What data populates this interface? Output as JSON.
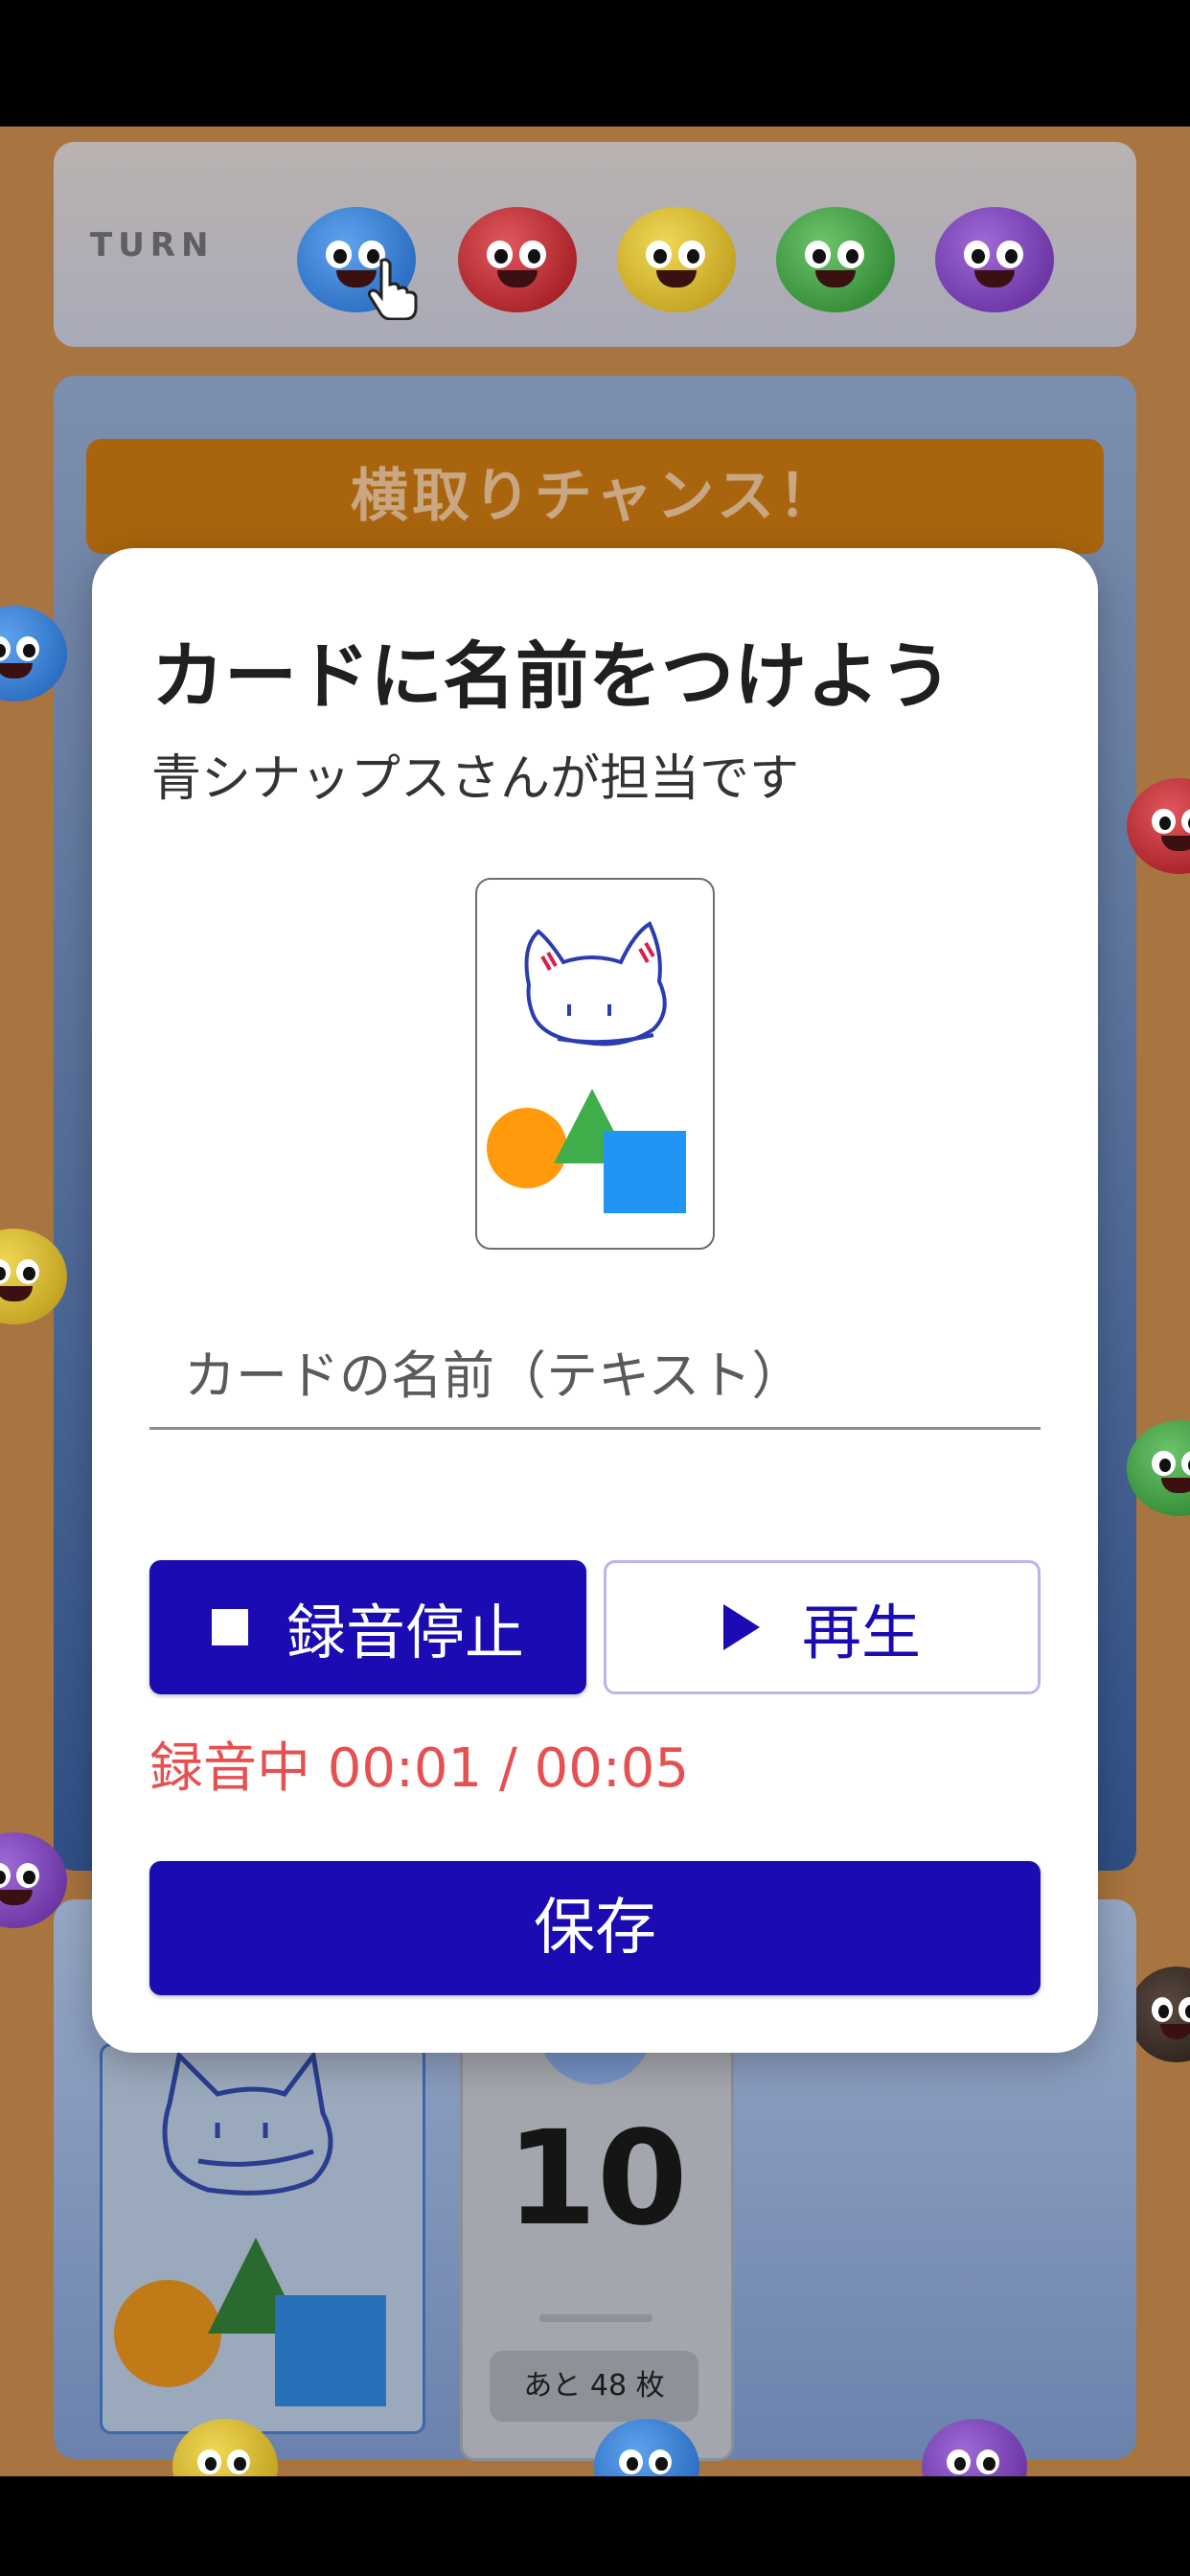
{
  "game": {
    "turn_label": "TURN",
    "banner": "横取りチャンス！",
    "deck": {
      "count": "10",
      "remaining": "あと 48 枚"
    },
    "players": [
      {
        "color": "#2b78d6"
      },
      {
        "color": "#c6202a"
      },
      {
        "color": "#d9b81c"
      },
      {
        "color": "#3a9a3b"
      },
      {
        "color": "#7a3fb5"
      }
    ]
  },
  "modal": {
    "title": "カードに名前をつけよう",
    "subtitle": "青シナップスさんが担当です",
    "name_placeholder": "カードの名前（テキスト）",
    "stop_label": "録音停止",
    "play_label": "再生",
    "recording_status": "録音中 00:01 / 00:05",
    "save_label": "保存"
  },
  "colors": {
    "primary": "#1a0bb3",
    "recording": "#e65050",
    "banner": "#a9650d"
  }
}
